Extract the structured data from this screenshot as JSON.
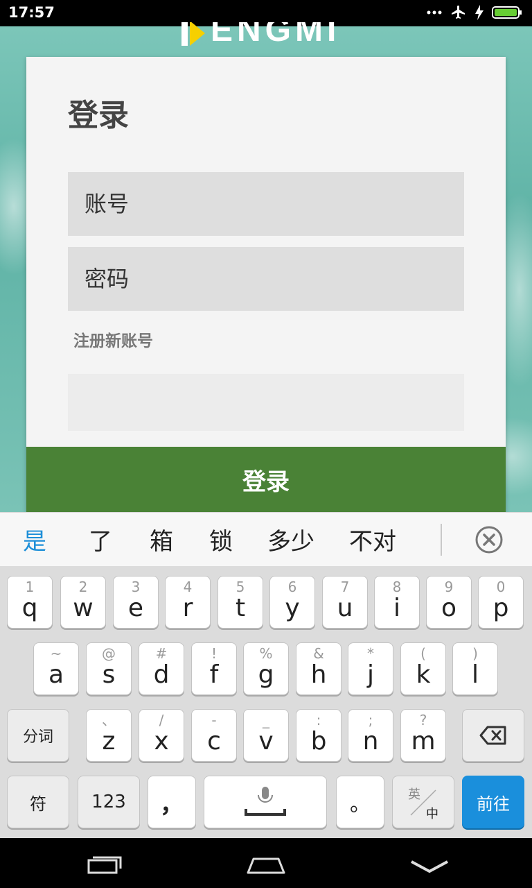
{
  "status_bar": {
    "time": "17:57",
    "icons": [
      "more-dots-icon",
      "airplane-icon",
      "charging-bolt-icon",
      "battery-icon"
    ]
  },
  "app": {
    "logo_text": "ENGMI",
    "accent_color": "#4a8236"
  },
  "login_card": {
    "title": "登录",
    "account_placeholder": "账号",
    "password_placeholder": "密码",
    "register_link": "注册新账号",
    "login_button": "登录"
  },
  "ime": {
    "candidates": [
      "是",
      "了",
      "箱",
      "锁",
      "多少",
      "不对"
    ],
    "selected_candidate_color": "#1e8fd8",
    "rows": [
      [
        {
          "sub": "1",
          "main": "q"
        },
        {
          "sub": "2",
          "main": "w"
        },
        {
          "sub": "3",
          "main": "e"
        },
        {
          "sub": "4",
          "main": "r"
        },
        {
          "sub": "5",
          "main": "t"
        },
        {
          "sub": "6",
          "main": "y"
        },
        {
          "sub": "7",
          "main": "u"
        },
        {
          "sub": "8",
          "main": "i"
        },
        {
          "sub": "9",
          "main": "o"
        },
        {
          "sub": "0",
          "main": "p"
        }
      ],
      [
        {
          "sub": "~",
          "main": "a"
        },
        {
          "sub": "@",
          "main": "s"
        },
        {
          "sub": "#",
          "main": "d"
        },
        {
          "sub": "!",
          "main": "f"
        },
        {
          "sub": "%",
          "main": "g"
        },
        {
          "sub": "&",
          "main": "h"
        },
        {
          "sub": "*",
          "main": "j"
        },
        {
          "sub": "(",
          "main": "k"
        },
        {
          "sub": ")",
          "main": "l"
        }
      ],
      [
        {
          "sub": "、",
          "main": "z"
        },
        {
          "sub": "/",
          "main": "x"
        },
        {
          "sub": "-",
          "main": "c"
        },
        {
          "sub": "_",
          "main": "v"
        },
        {
          "sub": ":",
          "main": "b"
        },
        {
          "sub": ";",
          "main": "n"
        },
        {
          "sub": "?",
          "main": "m"
        }
      ]
    ],
    "split_word_label": "分词",
    "symbol_label": "符",
    "numeric_label": "123",
    "comma_label": "，",
    "period_label": "。",
    "lang_switch_top": "英",
    "lang_switch_bottom": "中",
    "go_label": "前往",
    "go_color": "#1a8fdc"
  },
  "nav_bar": {
    "icons": [
      "recent-apps-icon",
      "home-icon",
      "back-icon"
    ]
  }
}
